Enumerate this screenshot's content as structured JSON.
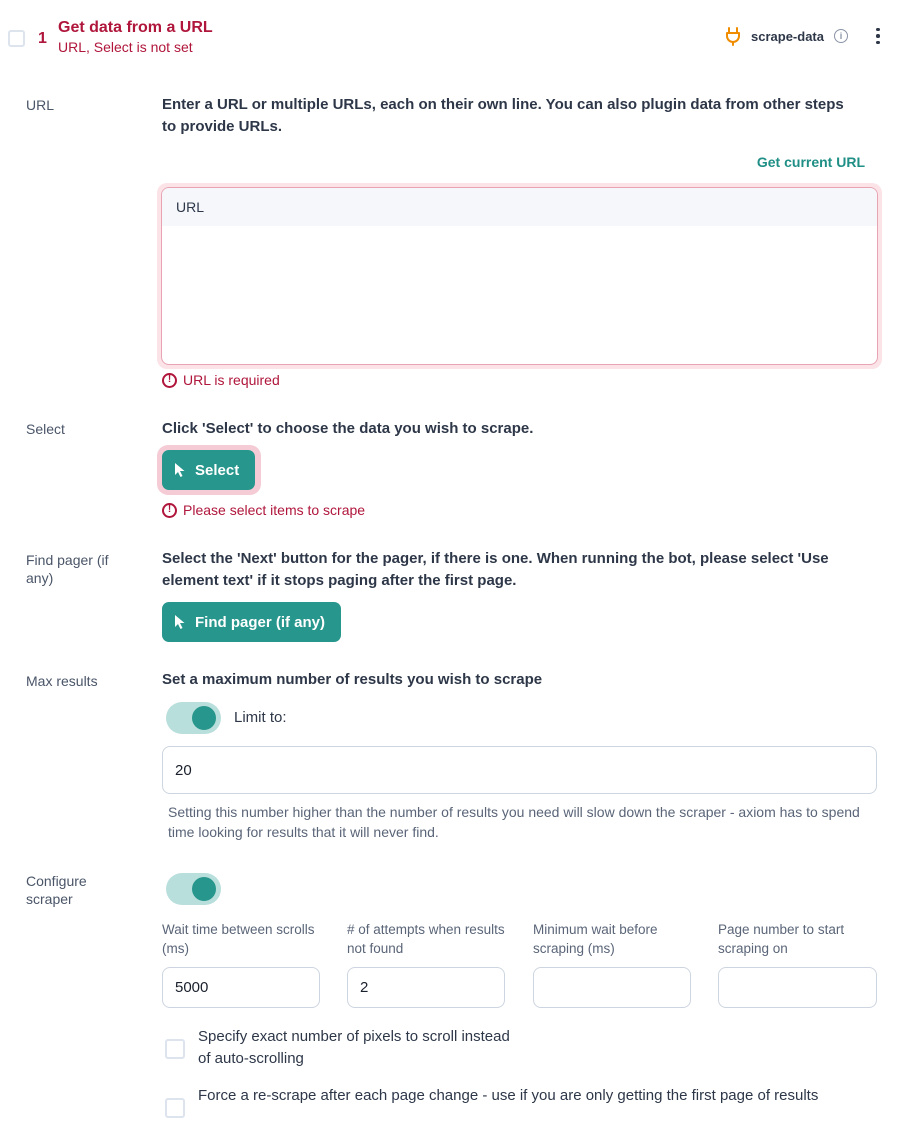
{
  "header": {
    "step_number": "1",
    "title": "Get data from a URL",
    "subtitle": "URL, Select is not set",
    "tag": "scrape-data",
    "tag_icon": "plug-icon",
    "info_icon": "info-icon",
    "menu_icon": "kebab-menu-icon"
  },
  "url_section": {
    "label": "URL",
    "description": "Enter a URL or multiple URLs, each on their own line. You can also plugin data from other steps to provide URLs.",
    "get_current_url_link": "Get current URL",
    "textarea_header": "URL",
    "textarea_value": "",
    "error": "URL is required"
  },
  "select_section": {
    "label": "Select",
    "description": "Click 'Select' to choose the data you wish to scrape.",
    "button_label": "Select",
    "error": "Please select items to scrape"
  },
  "pager_section": {
    "label": "Find pager (if any)",
    "description": "Select the 'Next' button for the pager, if there is one. When running the bot, please select 'Use element text' if it stops paging after the first page.",
    "button_label": "Find pager (if any)"
  },
  "max_results_section": {
    "label": "Max results",
    "description": "Set a maximum number of results you wish to scrape",
    "toggle_on": true,
    "toggle_label": "Limit to:",
    "limit_value": "20",
    "help_text": "Setting this number higher than the number of results you need will slow down the scraper - axiom has to spend time looking for results that it will never find."
  },
  "configure_section": {
    "label": "Configure scraper",
    "toggle_on": true,
    "fields": [
      {
        "label": "Wait time between scrolls (ms)",
        "value": "5000"
      },
      {
        "label": "# of attempts when results not found",
        "value": "2"
      },
      {
        "label": "Minimum wait before scraping (ms)",
        "value": ""
      },
      {
        "label": "Page number to start scraping on",
        "value": ""
      }
    ],
    "checkboxes": [
      {
        "label": "Specify exact number of pixels to scroll instead of auto-scrolling",
        "checked": false
      },
      {
        "label": "Force a re-scrape after each page change - use if you are only getting the first page of results",
        "checked": false
      }
    ]
  },
  "colors": {
    "error": "#b0163b",
    "accent": "#27968c",
    "accent_light": "#b9dfdc",
    "plug": "#f08c00"
  }
}
